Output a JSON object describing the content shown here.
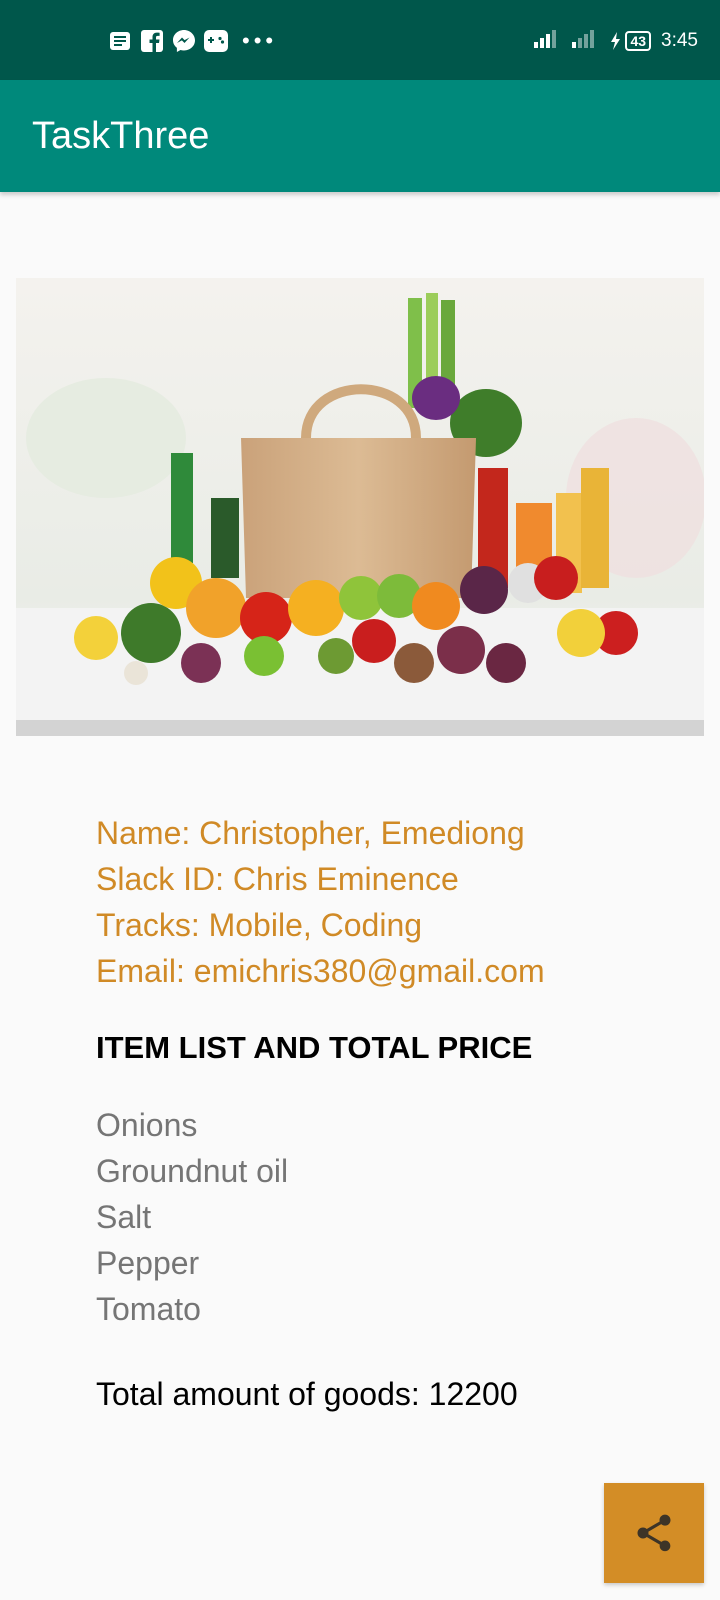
{
  "status_bar": {
    "time": "3:45",
    "battery": "43",
    "notification_icons": [
      "news-icon",
      "facebook-icon",
      "messenger-icon",
      "game-icon",
      "more-dots-icon"
    ]
  },
  "app_bar": {
    "title": "TaskThree"
  },
  "profile": {
    "name": "Name: Christopher, Emediong",
    "slack_id": "Slack ID: Chris Eminence",
    "tracks": "Tracks: Mobile, Coding",
    "email": "Email: emichris380@gmail.com"
  },
  "section_heading": "ITEM LIST AND TOTAL PRICE",
  "items": [
    "Onions",
    "Groundnut oil",
    "Salt",
    "Pepper",
    "Tomato"
  ],
  "total": "Total amount of goods: 12200",
  "fab": {
    "icon": "share-icon"
  },
  "colors": {
    "status_bar": "#00574b",
    "app_bar": "#00897b",
    "accent": "#d38d26",
    "info_text": "#d08a26"
  }
}
